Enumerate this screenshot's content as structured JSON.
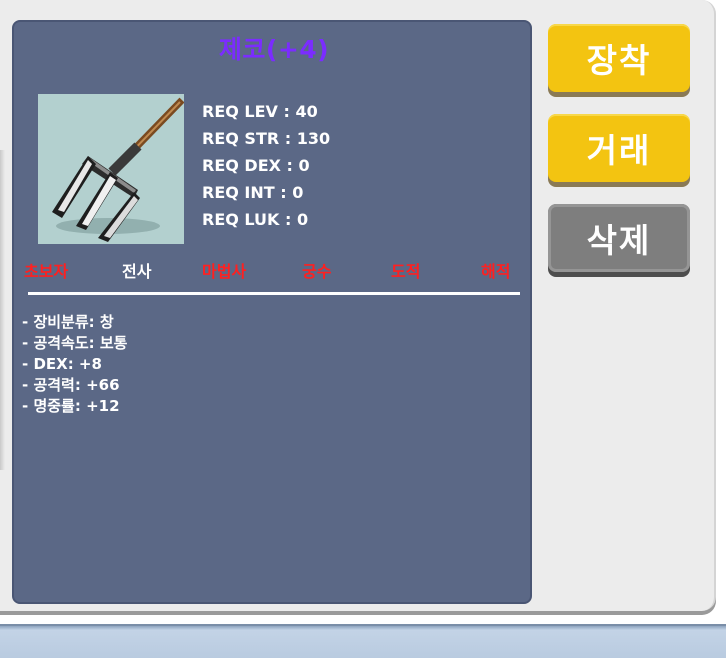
{
  "item": {
    "name": "제코(+4)",
    "name_color": "#7b2cff",
    "image_icon": "trident-spear-icon",
    "requirements": [
      "REQ LEV : 40",
      "REQ STR : 130",
      "REQ DEX : 0",
      "REQ INT : 0",
      "REQ LUK : 0"
    ],
    "classes": [
      {
        "label": "초보자",
        "color": "#ff2020"
      },
      {
        "label": "전사",
        "color": "#ffffff"
      },
      {
        "label": "마법사",
        "color": "#ff2020"
      },
      {
        "label": "궁수",
        "color": "#ff2020"
      },
      {
        "label": "도적",
        "color": "#ff2020"
      },
      {
        "label": "해적",
        "color": "#ff2020"
      }
    ],
    "stats": [
      "- 장비분류: 창",
      "- 공격속도: 보통",
      "- DEX: +8",
      "- 공격력: +66",
      "- 명중률: +12"
    ]
  },
  "buttons": {
    "equip_label": "장착",
    "trade_label": "거래",
    "delete_label": "삭제",
    "yellow_color": "#f3c411",
    "gray_color": "#7e7e7e"
  }
}
